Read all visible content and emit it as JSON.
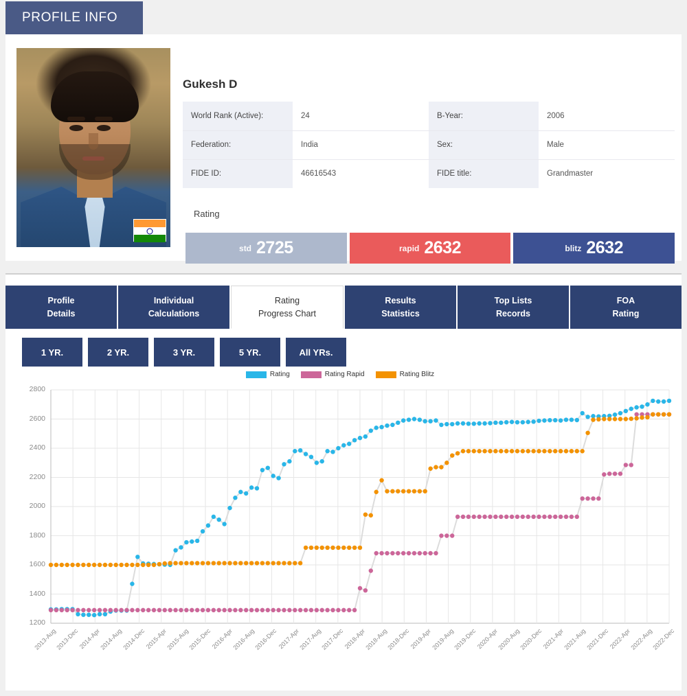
{
  "header": {
    "title": "PROFILE INFO"
  },
  "profile": {
    "name": "Gukesh D",
    "photo_alt": "player-photo",
    "flag": "india-flag",
    "info_rows": [
      {
        "k1": "World Rank (Active):",
        "v1": "24",
        "k2": "B-Year:",
        "v2": "2006"
      },
      {
        "k1": "Federation:",
        "v1": "India",
        "k2": "Sex:",
        "v2": "Male"
      },
      {
        "k1": "FIDE ID:",
        "v1": "46616543",
        "k2": "FIDE title:",
        "v2": "Grandmaster"
      }
    ],
    "rating_label": "Rating",
    "ratings": [
      {
        "label": "std",
        "value": "2725",
        "color": "#adb8cc"
      },
      {
        "label": "rapid",
        "value": "2632",
        "color": "#ea5b5b"
      },
      {
        "label": "blitz",
        "value": "2632",
        "color": "#3d5193"
      }
    ]
  },
  "tabs": [
    {
      "l1": "Profile",
      "l2": "Details",
      "active": false
    },
    {
      "l1": "Individual",
      "l2": "Calculations",
      "active": false
    },
    {
      "l1": "Rating",
      "l2": "Progress Chart",
      "active": true
    },
    {
      "l1": "Results",
      "l2": "Statistics",
      "active": false
    },
    {
      "l1": "Top Lists",
      "l2": "Records",
      "active": false
    },
    {
      "l1": "FOA",
      "l2": "Rating",
      "active": false
    }
  ],
  "range_buttons": [
    {
      "label": "1 YR.",
      "active": false
    },
    {
      "label": "2 YR.",
      "active": false
    },
    {
      "label": "3 YR.",
      "active": false
    },
    {
      "label": "5 YR.",
      "active": false
    },
    {
      "label": "All YRs.",
      "active": false
    }
  ],
  "chart_data": {
    "type": "scatter",
    "title": "",
    "xlabel": "",
    "ylabel": "",
    "ylim": [
      1200,
      2800
    ],
    "ytick_step": 200,
    "yticks": [
      1200,
      1400,
      1600,
      1800,
      2000,
      2200,
      2400,
      2600,
      2800
    ],
    "grid": true,
    "legend_position": "top-center",
    "xticks": [
      "2013-Aug",
      "2013-Dec",
      "2014-Apr",
      "2014-Aug",
      "2014-Dec",
      "2015-Apr",
      "2015-Aug",
      "2015-Dec",
      "2016-Apr",
      "2016-Aug",
      "2016-Dec",
      "2017-Apr",
      "2017-Aug",
      "2017-Dec",
      "2018-Apr",
      "2018-Aug",
      "2018-Dec",
      "2019-Apr",
      "2019-Aug",
      "2019-Dec",
      "2020-Apr",
      "2020-Aug",
      "2020-Dec",
      "2021-Apr",
      "2021-Aug",
      "2021-Dec",
      "2022-Apr",
      "2022-Aug",
      "2022-Dec"
    ],
    "x_start": "2013-Aug",
    "x_end": "2022-Dec",
    "x_interval_months": 1,
    "series": [
      {
        "name": "Rating",
        "color": "#29b6e8",
        "values": [
          1295,
          1295,
          1297,
          1297,
          1297,
          1262,
          1258,
          1258,
          1256,
          1262,
          1262,
          1280,
          1287,
          1287,
          1287,
          1470,
          1655,
          1610,
          1608,
          1606,
          1604,
          1602,
          1600,
          1700,
          1720,
          1755,
          1760,
          1765,
          1830,
          1870,
          1930,
          1910,
          1880,
          1990,
          2060,
          2100,
          2090,
          2130,
          2125,
          2250,
          2265,
          2210,
          2195,
          2290,
          2310,
          2380,
          2385,
          2360,
          2340,
          2300,
          2310,
          2380,
          2375,
          2400,
          2420,
          2430,
          2455,
          2470,
          2480,
          2520,
          2540,
          2545,
          2555,
          2560,
          2575,
          2590,
          2595,
          2600,
          2595,
          2585,
          2585,
          2590,
          2560,
          2565,
          2565,
          2570,
          2570,
          2568,
          2568,
          2570,
          2570,
          2572,
          2575,
          2575,
          2578,
          2580,
          2578,
          2578,
          2580,
          2582,
          2588,
          2590,
          2592,
          2592,
          2590,
          2595,
          2595,
          2593,
          2640,
          2615,
          2620,
          2618,
          2620,
          2622,
          2630,
          2640,
          2655,
          2670,
          2680,
          2685,
          2700,
          2725,
          2720,
          2720,
          2725
        ]
      },
      {
        "name": "Rating Rapid",
        "color": "#cc6699",
        "values": [
          1290,
          1290,
          1290,
          1290,
          1290,
          1290,
          1290,
          1290,
          1290,
          1290,
          1290,
          1290,
          1290,
          1290,
          1290,
          1290,
          1290,
          1290,
          1290,
          1290,
          1290,
          1290,
          1290,
          1290,
          1290,
          1290,
          1290,
          1290,
          1290,
          1290,
          1290,
          1290,
          1290,
          1290,
          1290,
          1290,
          1290,
          1290,
          1290,
          1290,
          1290,
          1290,
          1290,
          1290,
          1290,
          1290,
          1290,
          1290,
          1290,
          1290,
          1290,
          1290,
          1290,
          1290,
          1290,
          1290,
          1290,
          1440,
          1425,
          1560,
          1680,
          1680,
          1680,
          1680,
          1680,
          1680,
          1680,
          1680,
          1680,
          1680,
          1680,
          1680,
          1800,
          1800,
          1800,
          1930,
          1930,
          1930,
          1930,
          1930,
          1930,
          1930,
          1930,
          1930,
          1930,
          1930,
          1930,
          1930,
          1930,
          1930,
          1930,
          1930,
          1930,
          1930,
          1930,
          1930,
          1930,
          1930,
          2055,
          2055,
          2055,
          2055,
          2220,
          2225,
          2225,
          2225,
          2285,
          2285,
          2632,
          2632,
          2632,
          2632,
          2632,
          2632,
          2632
        ]
      },
      {
        "name": "Rating Blitz",
        "color": "#f39200",
        "values": [
          1600,
          1600,
          1600,
          1600,
          1600,
          1600,
          1600,
          1600,
          1600,
          1600,
          1600,
          1600,
          1600,
          1600,
          1600,
          1600,
          1600,
          1600,
          1600,
          1600,
          1605,
          1610,
          1612,
          1612,
          1612,
          1612,
          1612,
          1612,
          1612,
          1612,
          1612,
          1612,
          1612,
          1612,
          1612,
          1612,
          1612,
          1612,
          1612,
          1612,
          1612,
          1612,
          1612,
          1612,
          1612,
          1612,
          1612,
          1718,
          1718,
          1718,
          1718,
          1718,
          1718,
          1718,
          1718,
          1718,
          1718,
          1718,
          1945,
          1940,
          2100,
          2180,
          2105,
          2105,
          2105,
          2105,
          2105,
          2105,
          2105,
          2105,
          2260,
          2270,
          2270,
          2300,
          2350,
          2365,
          2380,
          2380,
          2380,
          2380,
          2380,
          2380,
          2380,
          2380,
          2380,
          2380,
          2380,
          2380,
          2380,
          2380,
          2380,
          2380,
          2380,
          2380,
          2380,
          2380,
          2380,
          2380,
          2380,
          2505,
          2595,
          2598,
          2600,
          2600,
          2600,
          2600,
          2600,
          2602,
          2605,
          2610,
          2612,
          2632,
          2632,
          2632,
          2632
        ]
      }
    ]
  }
}
